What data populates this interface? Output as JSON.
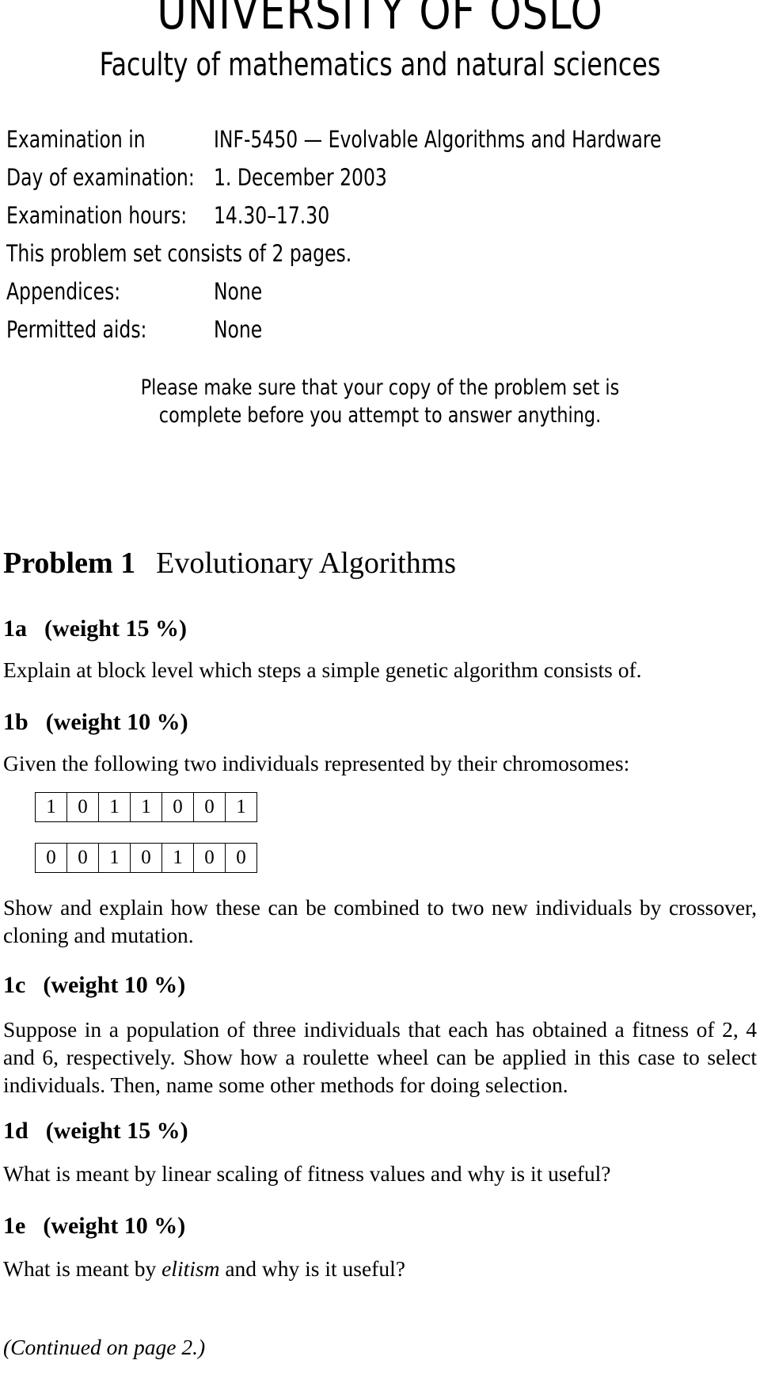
{
  "masthead": {
    "university": "UNIVERSITY OF OSLO",
    "faculty": "Faculty of mathematics and natural sciences"
  },
  "exam_info": {
    "rows": [
      {
        "label": "Examination in",
        "value": "INF-5450 — Evolvable Algorithms and Hardware"
      },
      {
        "label": "Day of examination:",
        "value": "1. December 2003"
      },
      {
        "label": "Examination hours:",
        "value": "14.30–17.30"
      }
    ],
    "pages_note": "This problem set consists of 2 pages.",
    "appendices_label": "Appendices:",
    "appendices_value": "None",
    "permitted_aids_label": "Permitted aids:",
    "permitted_aids_value": "None"
  },
  "notice": {
    "line1": "Please make sure that your copy of the problem set is",
    "line2": "complete before you attempt to answer anything."
  },
  "problem": {
    "number": "Problem 1",
    "title": "Evolutionary Algorithms"
  },
  "parts": {
    "a": {
      "id": "1a",
      "weight": "(weight 15 %)",
      "text": "Explain at block level which steps a simple genetic algorithm consists of."
    },
    "b": {
      "id": "1b",
      "weight": "(weight 10 %)",
      "intro": "Given the following two individuals represented by their chromosomes:",
      "outro": "Show and explain how these can be combined to two new individuals by crossover, cloning and mutation."
    },
    "c": {
      "id": "1c",
      "weight": "(weight 10 %)",
      "text": "Suppose in a population of three individuals that each has obtained a fitness of 2, 4 and 6, respectively. Show how a roulette wheel can be applied in this case to select individuals. Then, name some other methods for doing selection."
    },
    "d": {
      "id": "1d",
      "weight": "(weight 15 %)",
      "text": "What is meant by linear scaling of fitness values and why is it useful?"
    },
    "e": {
      "id": "1e",
      "weight": "(weight 10 %)",
      "text_before": "What is meant by ",
      "emphasis": "elitism",
      "text_after": " and why is it useful?"
    }
  },
  "chromosomes": {
    "individual_1": [
      "1",
      "0",
      "1",
      "1",
      "0",
      "0",
      "1"
    ],
    "individual_2": [
      "0",
      "0",
      "1",
      "0",
      "1",
      "0",
      "0"
    ]
  },
  "footer": {
    "continued": "(Continued on page 2.)"
  }
}
